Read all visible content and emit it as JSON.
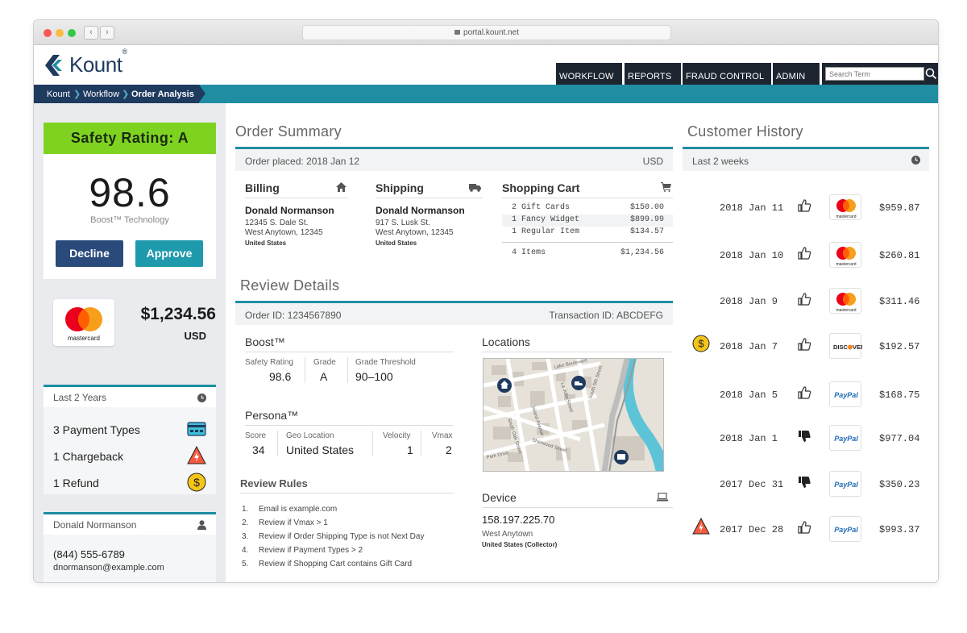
{
  "browser": {
    "url": "portal.kount.net"
  },
  "header": {
    "logo_text": "Kount",
    "nav": [
      "WORKFLOW",
      "REPORTS",
      "FRAUD CONTROL",
      "ADMIN"
    ],
    "search_placeholder": "Search Term"
  },
  "breadcrumb": [
    "Kount",
    "Workflow",
    "Order Analysis"
  ],
  "safety": {
    "title": "Safety Rating: A",
    "score": "98.6",
    "subtitle": "Boost™ Technology",
    "decline_label": "Decline",
    "approve_label": "Approve"
  },
  "payment": {
    "card_brand": "mastercard",
    "amount": "$1,234.56",
    "currency": "USD"
  },
  "history_summary": {
    "period": "Last 2 Years",
    "items": [
      "3 Payment Types",
      "1 Chargeback",
      "1 Refund"
    ]
  },
  "customer": {
    "name": "Donald Normanson",
    "phone": "(844) 555-6789",
    "email": "dnormanson@example.com"
  },
  "order_summary": {
    "title": "Order Summary",
    "placed": "Order placed: 2018 Jan 12",
    "currency": "USD",
    "billing": {
      "title": "Billing",
      "name": "Donald Normanson",
      "line1": "12345 S. Dale St.",
      "line2": "West Anytown, 12345",
      "country": "United States"
    },
    "shipping": {
      "title": "Shipping",
      "name": "Donald Normanson",
      "line1": "917 S. Lusk St.",
      "line2": "West Anytown, 12345",
      "country": "United States"
    },
    "cart": {
      "title": "Shopping Cart",
      "rows": [
        {
          "item": "2 Gift Cards",
          "price": "$150.00"
        },
        {
          "item": "1 Fancy Widget",
          "price": "$899.99"
        },
        {
          "item": "1 Regular Item",
          "price": "$134.57"
        }
      ],
      "total_items": "4 Items",
      "total": "$1,234.56"
    }
  },
  "review": {
    "title": "Review Details",
    "order_id": "Order ID: 1234567890",
    "transaction_id": "Transaction ID: ABCDEFG",
    "boost": {
      "title": "Boost™",
      "labels": [
        "Safety Rating",
        "Grade",
        "Grade Threshold"
      ],
      "values": [
        "98.6",
        "A",
        "90–100"
      ]
    },
    "persona": {
      "title": "Persona™",
      "labels": [
        "Score",
        "Geo Location",
        "Velocity",
        "Vmax"
      ],
      "values": [
        "34",
        "United States",
        "1",
        "2"
      ]
    },
    "rules": {
      "title": "Review Rules",
      "items": [
        "Email is example.com",
        "Review if Vmax > 1",
        "Review if Order Shipping Type is not Next Day",
        "Review if Payment Types > 2",
        "Review if Shopping Cart contains Gift Card"
      ]
    },
    "locations": {
      "title": "Locations",
      "streets": [
        "Island Avenue",
        "La Jolla Street",
        "South 5th Street",
        "Sherwood Street",
        "Dale Street",
        "Lake Boulevard",
        "South Oak Street",
        "Lusk Street",
        "Park Drive",
        "South 9th Street"
      ]
    },
    "device": {
      "title": "Device",
      "ip": "158.197.225.70",
      "city": "West Anytown",
      "country": "United States (Collector)"
    }
  },
  "customer_history": {
    "title": "Customer History",
    "period": "Last 2 weeks",
    "rows": [
      {
        "date": "2018 Jan 11",
        "thumb": "up",
        "card": "mastercard",
        "amount": "$959.87",
        "badge": ""
      },
      {
        "date": "2018 Jan 10",
        "thumb": "up",
        "card": "mastercard",
        "amount": "$260.81",
        "badge": ""
      },
      {
        "date": "2018 Jan 9",
        "thumb": "up",
        "card": "mastercard",
        "amount": "$311.46",
        "badge": ""
      },
      {
        "date": "2018 Jan 7",
        "thumb": "up",
        "card": "discover",
        "amount": "$192.57",
        "badge": "refund"
      },
      {
        "date": "2018 Jan 5",
        "thumb": "up",
        "card": "paypal",
        "amount": "$168.75",
        "badge": ""
      },
      {
        "date": "2018 Jan 1",
        "thumb": "down",
        "card": "paypal",
        "amount": "$977.04",
        "badge": ""
      },
      {
        "date": "2017 Dec 31",
        "thumb": "down",
        "card": "paypal",
        "amount": "$350.23",
        "badge": ""
      },
      {
        "date": "2017 Dec 28",
        "thumb": "up",
        "card": "paypal",
        "amount": "$993.37",
        "badge": "chargeback"
      }
    ],
    "card_labels": {
      "mastercard": "mastercard",
      "discover": "DISCOVER",
      "paypal": "PayPal"
    }
  },
  "colors": {
    "navy": "#1f3a5f",
    "teal": "#1f8ea3",
    "green": "#7ed321",
    "decline": "#2a4a7b",
    "approve": "#1f9aad"
  }
}
